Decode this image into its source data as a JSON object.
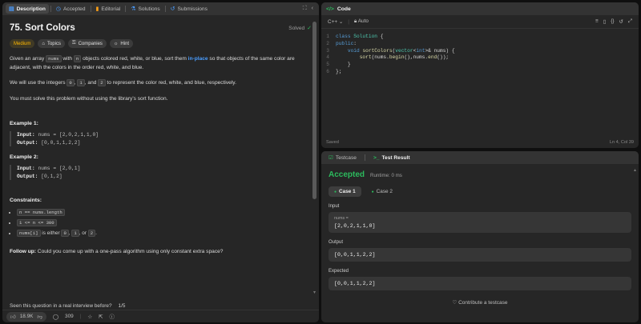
{
  "tabs": [
    {
      "label": "Description",
      "icon": "description-icon"
    },
    {
      "label": "Accepted",
      "icon": "accepted-icon"
    },
    {
      "label": "Editorial",
      "icon": "editorial-icon"
    },
    {
      "label": "Solutions",
      "icon": "solutions-icon"
    },
    {
      "label": "Submissions",
      "icon": "submissions-icon"
    }
  ],
  "problem": {
    "title": "75. Sort Colors",
    "status": "Solved",
    "chips": [
      "Medium",
      "Topics",
      "Companies",
      "Hint"
    ],
    "desc1_a": "Given an array ",
    "desc1_code1": "nums",
    "desc1_b": " with ",
    "desc1_code2": "n",
    "desc1_c": " objects colored red, white, or blue, sort them ",
    "desc1_link": "in-place",
    "desc1_d": " so that objects of the same color are adjacent, with the colors in the order red, white, and blue.",
    "desc2_a": "We will use the integers ",
    "desc2_c0": "0",
    "desc2_b": ", ",
    "desc2_c1": "1",
    "desc2_c": ", and ",
    "desc2_c2": "2",
    "desc2_d": " to represent the color red, white, and blue, respectively.",
    "desc3": "You must solve this problem without using the library's sort function.",
    "examples": [
      {
        "heading": "Example 1:",
        "input_label": "Input:",
        "input": " nums = [2,0,2,1,1,0]",
        "output_label": "Output:",
        "output": " [0,0,1,1,2,2]"
      },
      {
        "heading": "Example 2:",
        "input_label": "Input:",
        "input": " nums = [2,0,1]",
        "output_label": "Output:",
        "output": " [0,1,2]"
      }
    ],
    "constraints_heading": "Constraints:",
    "c1": "n == nums.length",
    "c2": "1 <= n <= 300",
    "c3_code": "nums[i]",
    "c3_a": " is either ",
    "c3_v0": "0",
    "c3_b": ", ",
    "c3_v1": "1",
    "c3_c": ", or ",
    "c3_v2": "2",
    "c3_d": ".",
    "followup_label": "Follow up:",
    "followup_text": " Could you come up with a one-pass algorithm using only constant extra space?",
    "seen_q": "Seen this question in a real interview before?",
    "seen_count": "1/5"
  },
  "bottom": {
    "likes": "18.9K",
    "comments": "309"
  },
  "code": {
    "header": "Code",
    "language": "C++",
    "mode": "Auto",
    "lines": [
      {
        "n": "1",
        "html": "class Solution {"
      },
      {
        "n": "2",
        "html": "public:"
      },
      {
        "n": "3",
        "html": "    void sortColors(vector<int>& nums) {"
      },
      {
        "n": "4",
        "html": "        sort(nums.begin(),nums.end());"
      },
      {
        "n": "5",
        "html": "    }"
      },
      {
        "n": "6",
        "html": "};"
      }
    ],
    "saved": "Saved",
    "cursor": "Ln 4, Col 39"
  },
  "result": {
    "tab1": "Testcase",
    "tab2": "Test Result",
    "status": "Accepted",
    "runtime": "Runtime: 0 ms",
    "case1": "Case 1",
    "case2": "Case 2",
    "input_label": "Input",
    "input_name": "nums =",
    "input_value": "[2,0,2,1,1,0]",
    "output_label": "Output",
    "output_value": "[0,0,1,1,2,2]",
    "expected_label": "Expected",
    "expected_value": "[0,0,1,1,2,2]",
    "contribute": "Contribute a testcase"
  }
}
